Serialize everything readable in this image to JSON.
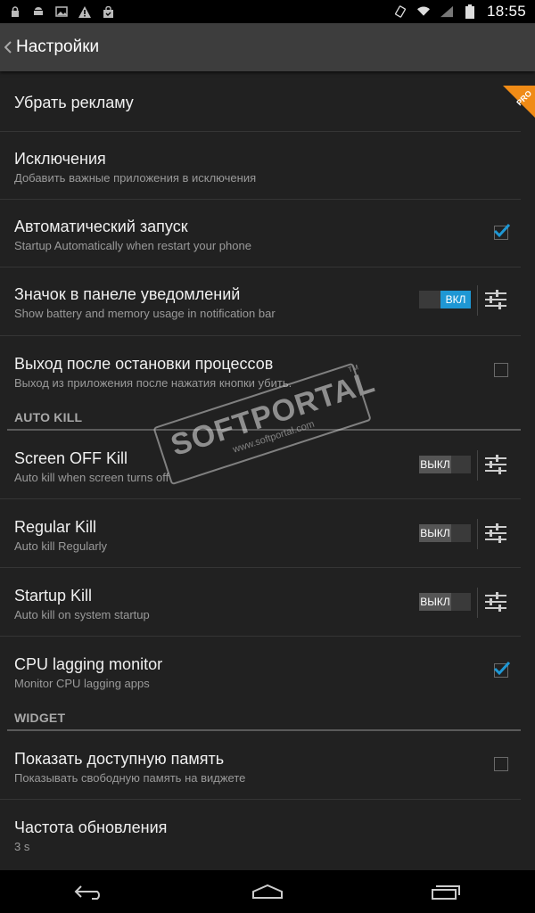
{
  "status_bar": {
    "time": "18:55",
    "icons_left": [
      "lock-icon",
      "android-icon",
      "image-icon",
      "warning-icon",
      "bag-icon"
    ],
    "icons_right": [
      "rotate-icon",
      "wifi-icon",
      "signal-icon",
      "battery-icon"
    ]
  },
  "action_bar": {
    "title": "Настройки"
  },
  "items": [
    {
      "title": "Убрать рекламу",
      "badge": "PRO"
    },
    {
      "title": "Исключения",
      "subtitle": "Добавить важные приложения в исключения"
    },
    {
      "title": "Автоматический запуск",
      "subtitle": "Startup Automatically when restart your phone",
      "checked": true
    },
    {
      "title": "Значок в панеле уведомлений",
      "subtitle": "Show battery and memory usage in notification bar",
      "toggle": "ВКЛ",
      "toggle_on": true
    },
    {
      "title": "Выход после остановки процессов",
      "subtitle": "Выход из приложения после нажатия кнопки убить.",
      "checked": false
    }
  ],
  "section_auto_kill": "AUTO KILL",
  "auto_kill_items": [
    {
      "title": "Screen OFF Kill",
      "subtitle": "Auto kill when screen turns off",
      "toggle": "ВЫКЛ",
      "toggle_on": false
    },
    {
      "title": "Regular Kill",
      "subtitle": "Auto kill Regularly",
      "toggle": "ВЫКЛ",
      "toggle_on": false
    },
    {
      "title": "Startup Kill",
      "subtitle": "Auto kill on system startup",
      "toggle": "ВЫКЛ",
      "toggle_on": false
    },
    {
      "title": "CPU lagging monitor",
      "subtitle": "Monitor CPU lagging apps",
      "checked": true
    }
  ],
  "section_widget": "WIDGET",
  "widget_items": [
    {
      "title": "Показать доступную память",
      "subtitle": "Показывать свободную память на виджете",
      "checked": false
    },
    {
      "title": "Частота обновления",
      "subtitle": "3 s"
    }
  ],
  "watermark": {
    "text": "SOFTPORTAL",
    "url": "www.softportal.com",
    "tm": "TM"
  },
  "colors": {
    "accent": "#1e97d4",
    "pro_badge": "#f08b16",
    "background": "#212121"
  }
}
